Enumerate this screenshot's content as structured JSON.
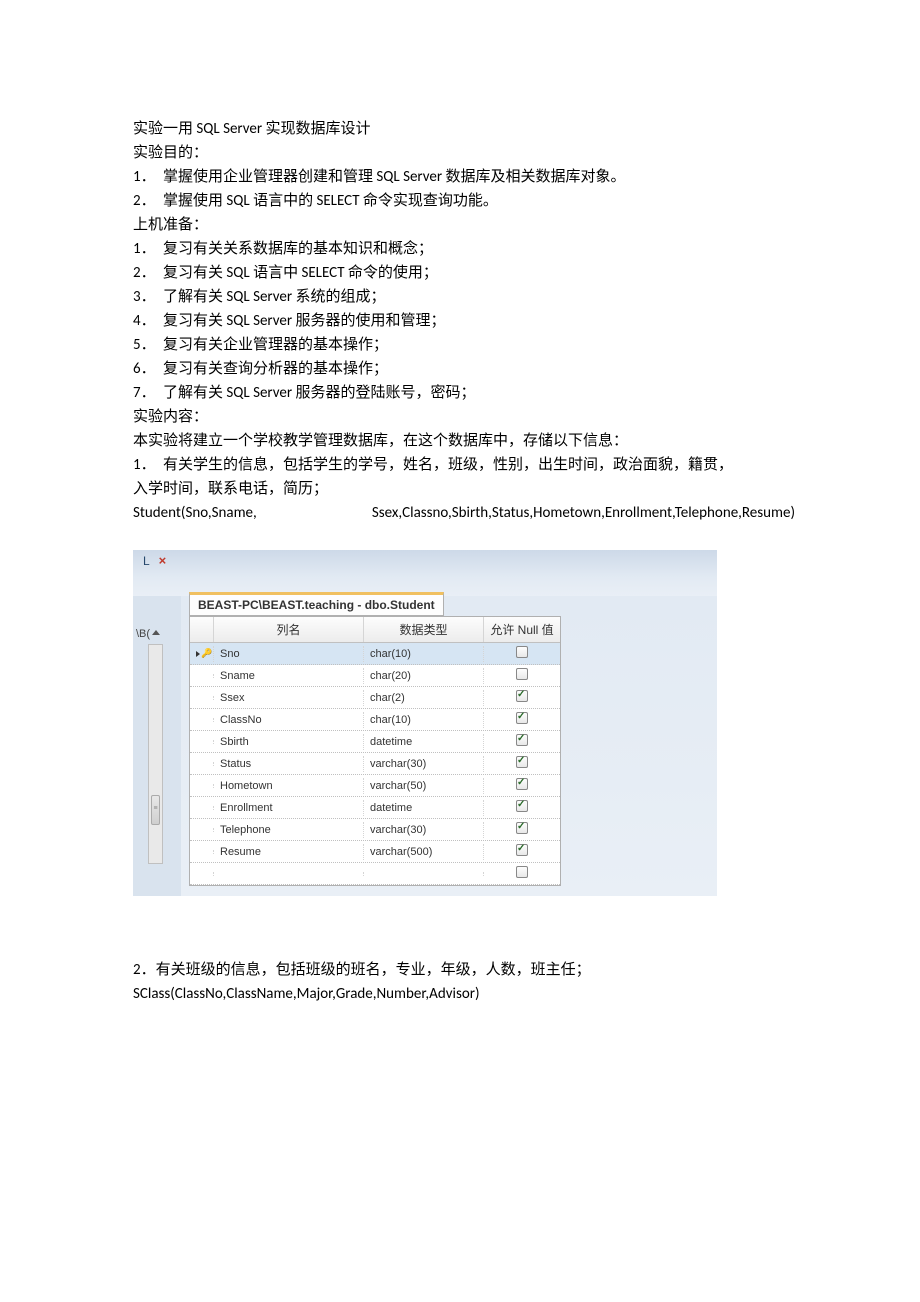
{
  "doc": {
    "title": "实验一用 SQL Server 实现数据库设计",
    "section_goal": "实验目的：",
    "goals": [
      "掌握使用企业管理器创建和管理 SQL Server 数据库及相关数据库对象。",
      "掌握使用 SQL 语言中的 SELECT 命令实现查询功能。"
    ],
    "section_prep": "上机准备：",
    "preps": [
      "复习有关关系数据库的基本知识和概念；",
      "复习有关 SQL 语言中 SELECT 命令的使用；",
      "了解有关 SQL Server 系统的组成；",
      "复习有关 SQL Server 服务器的使用和管理；",
      "复习有关企业管理器的基本操作；",
      "复习有关查询分析器的基本操作；",
      "了解有关 SQL Server 服务器的登陆账号，密码；"
    ],
    "section_content": "实验内容：",
    "content_intro": "本实验将建立一个学校教学管理数据库，在这个数据库中，存储以下信息：",
    "num1": "1．",
    "content1_a": "有关学生的信息，包括学生的学号，姓名，班级，性别，出生时间，政治面貌，籍贯，",
    "content1_b": "入学时间，联系电话，简历；",
    "schema1_left": "Student(Sno,Sname,",
    "schema1_right": "Ssex,Classno,Sbirth,Status,Hometown,Enrollment,Telephone,Resume)",
    "num2": "2．",
    "content2": "有关班级的信息，包括班级的班名，专业，年级，人数，班主任；",
    "schema2": "SClass(ClassNo,ClassName,Major,Grade,Number,Advisor)"
  },
  "ui": {
    "tab_title": "BEAST-PC\\BEAST.teaching - dbo.Student",
    "left_label": "\\B(",
    "headers": {
      "name": "列名",
      "type": "数据类型",
      "null": "允许 Null 值"
    },
    "rows": [
      {
        "name": "Sno",
        "type": "char(10)",
        "null": false,
        "pk": true
      },
      {
        "name": "Sname",
        "type": "char(20)",
        "null": false,
        "pk": false
      },
      {
        "name": "Ssex",
        "type": "char(2)",
        "null": true,
        "pk": false
      },
      {
        "name": "ClassNo",
        "type": "char(10)",
        "null": true,
        "pk": false
      },
      {
        "name": "Sbirth",
        "type": "datetime",
        "null": true,
        "pk": false
      },
      {
        "name": "Status",
        "type": "varchar(30)",
        "null": true,
        "pk": false
      },
      {
        "name": "Hometown",
        "type": "varchar(50)",
        "null": true,
        "pk": false
      },
      {
        "name": "Enrollment",
        "type": "datetime",
        "null": true,
        "pk": false
      },
      {
        "name": "Telephone",
        "type": "varchar(30)",
        "null": true,
        "pk": false
      },
      {
        "name": "Resume",
        "type": "varchar(500)",
        "null": true,
        "pk": false
      }
    ]
  }
}
